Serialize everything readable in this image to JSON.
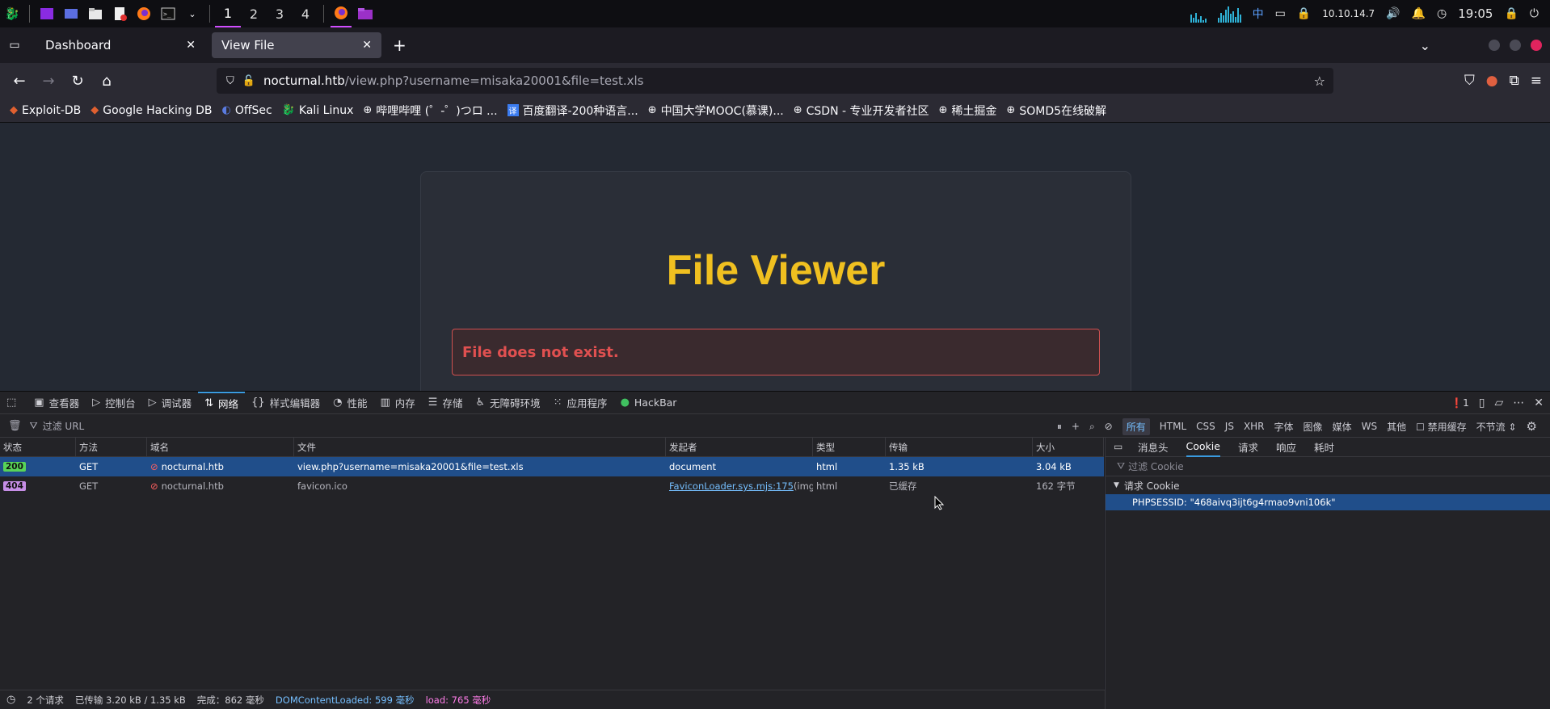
{
  "taskbar": {
    "workspaces": [
      "1",
      "2",
      "3",
      "4"
    ],
    "tray": {
      "ime": "中",
      "ip": "10.10.14.7",
      "clock": "19:05"
    }
  },
  "tabs": [
    {
      "label": "Dashboard"
    },
    {
      "label": "View File"
    }
  ],
  "url": {
    "host": "nocturnal.htb",
    "path": "/view.php?username=misaka20001&file=test.xls"
  },
  "bookmarks": [
    "Exploit-DB",
    "Google Hacking DB",
    "OffSec",
    "Kali Linux",
    "哔哩哔哩 (゜-゜)つロ ...",
    "百度翻译-200种语言...",
    "中国大学MOOC(慕课)...",
    "CSDN - 专业开发者社区",
    "稀土掘金",
    "SOMD5在线破解"
  ],
  "page": {
    "title": "File Viewer",
    "error": "File does not exist."
  },
  "devtools": {
    "tools": [
      "查看器",
      "控制台",
      "调试器",
      "网络",
      "样式编辑器",
      "性能",
      "内存",
      "存储",
      "无障碍环境",
      "应用程序",
      "HackBar"
    ],
    "error_count": "1",
    "filter_placeholder": "过滤 URL",
    "type_filters": [
      "所有",
      "HTML",
      "CSS",
      "JS",
      "XHR",
      "字体",
      "图像",
      "媒体",
      "WS",
      "其他"
    ],
    "disable_cache": "禁用缓存",
    "throttle": "不节流 ⇕",
    "columns": [
      "状态",
      "方法",
      "域名",
      "文件",
      "发起者",
      "类型",
      "传输",
      "大小"
    ],
    "rows": [
      {
        "status": "200",
        "method": "GET",
        "domain": "nocturnal.htb",
        "file": "view.php?username=misaka20001&file=test.xls",
        "initiator": "document",
        "initiator_extra": "",
        "type": "html",
        "transfer": "1.35 kB",
        "size": "3.04 kB"
      },
      {
        "status": "404",
        "method": "GET",
        "domain": "nocturnal.htb",
        "file": "favicon.ico",
        "initiator": "FaviconLoader.sys.mjs:175",
        "initiator_extra": " (img)",
        "type": "html",
        "transfer": "已缓存",
        "size": "162 字节"
      }
    ],
    "side_tabs": [
      "消息头",
      "Cookie",
      "请求",
      "响应",
      "耗时"
    ],
    "cookie_filter": "过滤 Cookie",
    "request_cookie": "请求 Cookie",
    "cookie": "PHPSESSID: \"468aivq3ijt6g4rmao9vni106k\"",
    "status": {
      "requests": "2 个请求",
      "transferred": "已传输 3.20 kB / 1.35 kB",
      "finish": "完成：862 毫秒",
      "dcl": "DOMContentLoaded: 599 毫秒",
      "load": "load: 765 毫秒"
    }
  }
}
